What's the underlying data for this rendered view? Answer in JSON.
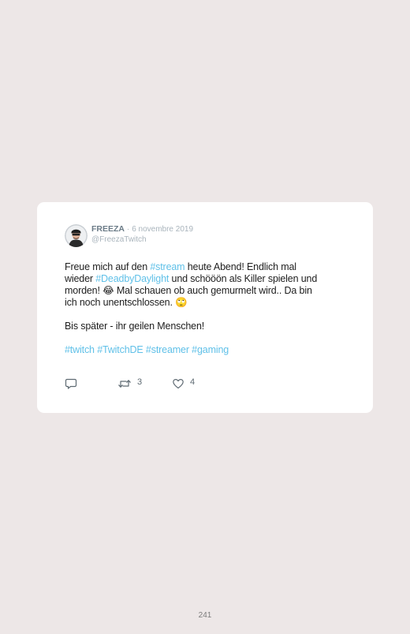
{
  "tweet": {
    "author_name": "FREEZA",
    "separator": "·",
    "date": "6 novembre 2019",
    "handle": "@FreezaTwitch",
    "lines": {
      "l1_a": "Freue mich auf den ",
      "l1_tag": "#stream",
      "l1_b": " heute Abend! Endlich mal",
      "l2_a": "wieder ",
      "l2_tag": "#DeadbyDaylight",
      "l2_b": " und schööön als Killer spielen und",
      "l3": "morden! 😂 Mal schauen ob auch gemurmelt wird.. Da bin",
      "l4": "ich noch unentschlossen. 🙄",
      "p2": "Bis später - ihr geilen Menschen!"
    },
    "hashtags": [
      "#twitch",
      "#TwitchDE",
      "#streamer",
      "#gaming"
    ],
    "actions": {
      "retweet_count": "3",
      "like_count": "4"
    }
  },
  "footer": {
    "page_number": "241"
  },
  "colors": {
    "background": "#ede7e7",
    "card": "#ffffff",
    "hashtag": "#5fc0e8",
    "name": "#6b7b87",
    "muted": "#a9b4bc"
  },
  "icons": {
    "reply": "reply-icon",
    "retweet": "retweet-icon",
    "like": "heart-icon"
  }
}
